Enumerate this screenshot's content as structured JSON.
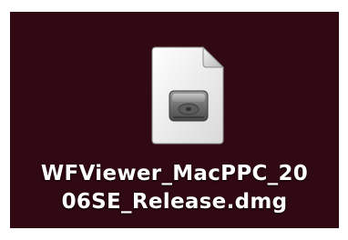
{
  "desktop": {
    "background_color": "#300912",
    "items": [
      {
        "icon": "disk-image-icon",
        "name_line_1": "WFViewer_MacPPC_20",
        "name_line_2": "06SE_Release.dmg"
      }
    ]
  }
}
